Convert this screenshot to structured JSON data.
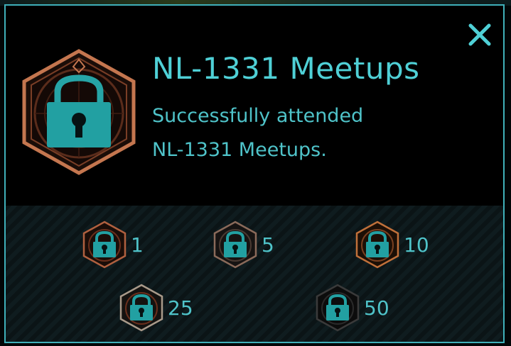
{
  "medal": {
    "title": "NL-1331 Meetups",
    "description_line1": "Successfully attended",
    "description_line2": "NL-1331 Meetups.",
    "icon": "padlock-icon"
  },
  "tiers": [
    {
      "label": "1",
      "name": "bronze"
    },
    {
      "label": "5",
      "name": "silver"
    },
    {
      "label": "10",
      "name": "gold"
    },
    {
      "label": "25",
      "name": "platinum"
    },
    {
      "label": "50",
      "name": "onyx"
    }
  ],
  "colors": {
    "accent": "#4fd0d6",
    "border": "#3fb0ba",
    "badge_rim": "#b86a4a"
  }
}
